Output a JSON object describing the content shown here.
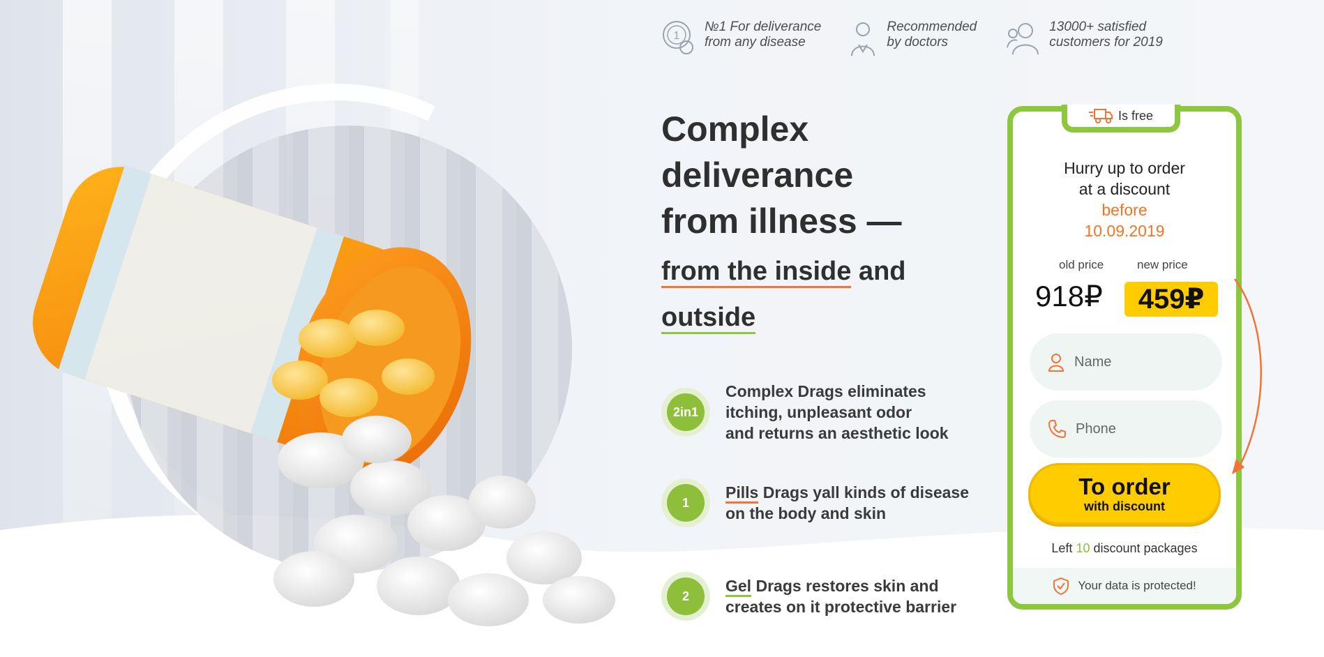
{
  "badges": [
    {
      "icon": "medal-1-icon",
      "text": "№1 For deliverance\nfrom any disease"
    },
    {
      "icon": "doctor-icon",
      "text": "Recommended\nby doctors"
    },
    {
      "icon": "customers-icon",
      "text": "13000+ satisfied\ncustomers for 2019"
    }
  ],
  "headline": {
    "title": "Complex\ndeliverance\nfrom illness —",
    "part1": "from the inside",
    "part2": " and",
    "part3": "outside"
  },
  "features": [
    {
      "badge": "2in1",
      "key": "",
      "text": "Complex Drags eliminates\nitching, unpleasant odor\nand returns an aesthetic look"
    },
    {
      "badge": "1",
      "key": "Pills",
      "text": " Drags yall kinds of disease\non the body and skin"
    },
    {
      "badge": "2",
      "key": "Gel",
      "text": " Drags restores skin and\ncreates on it protective barrier"
    }
  ],
  "card": {
    "tab_label": "Is free",
    "hurry_line1": "Hurry up to order",
    "hurry_line2": "at a discount",
    "hurry_before": "before",
    "hurry_date": "10.09.2019",
    "old_label": "old price",
    "new_label": "new price",
    "old_price": "918₽",
    "new_price": "459₽",
    "name_placeholder": "Name",
    "phone_placeholder": "Phone",
    "order_main": "To order",
    "order_sub": "with discount",
    "left_prefix": "Left ",
    "left_count": "10",
    "left_suffix": " discount packages",
    "secure_text": "Your data is protected!"
  },
  "colors": {
    "green": "#8dc63f",
    "orange": "#f37335",
    "yellow": "#ffcc00"
  }
}
